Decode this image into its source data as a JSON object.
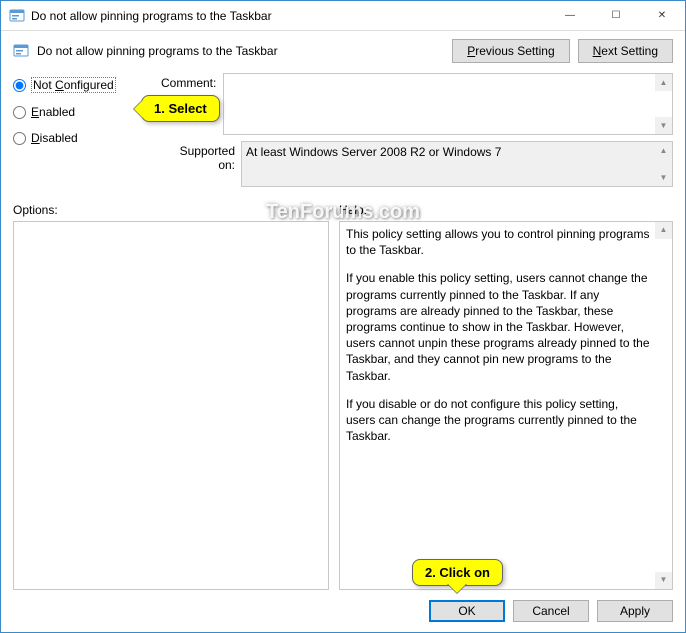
{
  "window": {
    "title": "Do not allow pinning programs to the Taskbar",
    "minimize_glyph": "—",
    "maximize_glyph": "☐",
    "close_glyph": "✕"
  },
  "header": {
    "title": "Do not allow pinning programs to the Taskbar",
    "prev_button": "Previous Setting",
    "next_button": "Next Setting",
    "prev_mnemonic": "P",
    "next_mnemonic": "N"
  },
  "radios": {
    "not_configured": "Not Configured",
    "enabled": "Enabled",
    "disabled": "Disabled",
    "selected": "not_configured"
  },
  "fields": {
    "comment_label": "Comment:",
    "comment_value": "",
    "supported_label": "Supported on:",
    "supported_value": "At least Windows Server 2008 R2 or Windows 7"
  },
  "sections": {
    "options_label": "Options:",
    "help_label": "Help:"
  },
  "help": {
    "p1": "This policy setting allows you to control pinning programs to the Taskbar.",
    "p2": "If you enable this policy setting, users cannot change the programs currently pinned to the Taskbar. If any programs are already pinned to the Taskbar, these programs continue to show in the Taskbar. However, users cannot unpin these programs already pinned to the Taskbar, and they cannot pin new programs to the Taskbar.",
    "p3": "If you disable or do not configure this policy setting, users can change the programs currently pinned to the Taskbar."
  },
  "buttons": {
    "ok": "OK",
    "cancel": "Cancel",
    "apply": "Apply"
  },
  "annotations": {
    "select": "1. Select",
    "click": "2. Click on"
  },
  "watermark": "TenForums.com"
}
